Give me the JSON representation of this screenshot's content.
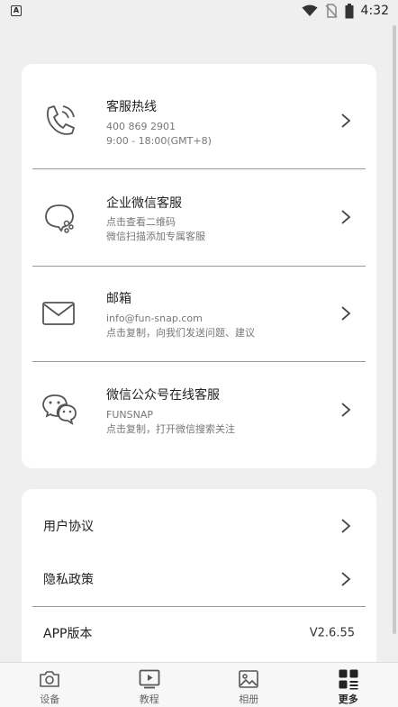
{
  "status_bar": {
    "time": "4:32",
    "notification_icon": "a-icon",
    "battery_level": "2"
  },
  "contact_card": {
    "rows": [
      {
        "title": "客服热线",
        "lines": [
          "400 869 2901",
          "9:00 - 18:00(GMT+8)"
        ],
        "icon": "phone-icon"
      },
      {
        "title": "企业微信客服",
        "lines": [
          "点击查看二维码",
          "微信扫描添加专属客服"
        ],
        "icon": "wecom-chat-icon"
      },
      {
        "title": "邮箱",
        "lines": [
          "info@fun-snap.com",
          "点击复制，向我们发送问题、建议"
        ],
        "icon": "mail-icon"
      },
      {
        "title": "微信公众号在线客服",
        "lines": [
          "FUNSNAP",
          "点击复制，打开微信搜索关注"
        ],
        "icon": "wechat-icon"
      }
    ]
  },
  "settings_card": {
    "user_agreement": "用户协议",
    "privacy_policy": "隐私政策",
    "app_version_label": "APP版本",
    "app_version_value": "V2.6.55"
  },
  "tab_bar": {
    "tabs": [
      {
        "label": "设备",
        "icon": "camera-icon"
      },
      {
        "label": "教程",
        "icon": "video-icon"
      },
      {
        "label": "相册",
        "icon": "image-icon"
      },
      {
        "label": "更多",
        "icon": "grid-icon",
        "active": true
      }
    ]
  }
}
